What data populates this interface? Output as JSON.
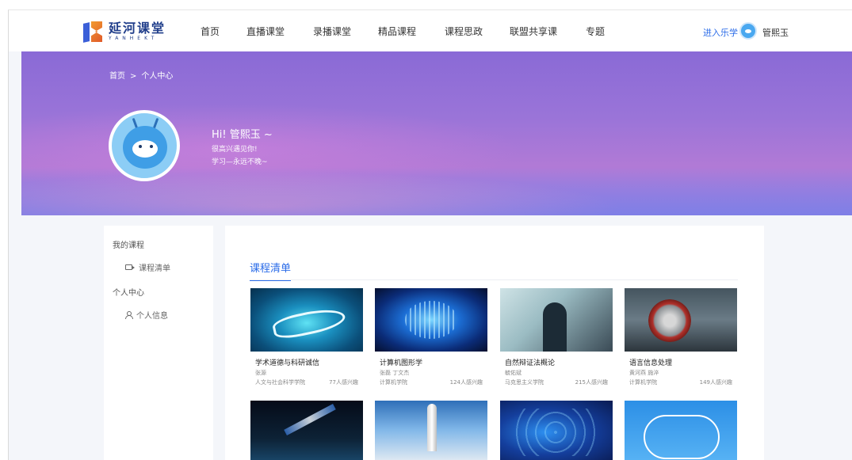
{
  "header": {
    "logo_cn": "延河课堂",
    "logo_en": "YANHEKT",
    "nav": [
      "首页",
      "直播课堂",
      "录播课堂",
      "精品课程",
      "课程思政",
      "联盟共享课",
      "专题"
    ],
    "enter_label": "进入乐学",
    "user_name": "管熙玉"
  },
  "banner": {
    "breadcrumb_home": "首页",
    "breadcrumb_sep": ">",
    "breadcrumb_current": "个人中心",
    "greeting": "Hi! 管熙玉 ~",
    "line1": "很高兴遇见你!",
    "line2": "学习—永远不晚~"
  },
  "sidebar": {
    "section1": "我的课程",
    "item1": "课程清单",
    "section2": "个人中心",
    "item2": "个人信息"
  },
  "main": {
    "tab": "课程清单",
    "courses": [
      {
        "title": "学术道德与科研诚信",
        "teacher": "张源",
        "college": "人文与社会科学学院",
        "interest": "77人感兴趣"
      },
      {
        "title": "计算机图形学",
        "teacher": "张磊 丁文杰",
        "college": "计算机学院",
        "interest": "124人感兴趣"
      },
      {
        "title": "自然辩证法概论",
        "teacher": "毓佑斌",
        "college": "马克思主义学院",
        "interest": "215人感兴趣"
      },
      {
        "title": "语言信息处理",
        "teacher": "黄河燕 施淬",
        "college": "计算机学院",
        "interest": "149人感兴趣"
      }
    ]
  }
}
